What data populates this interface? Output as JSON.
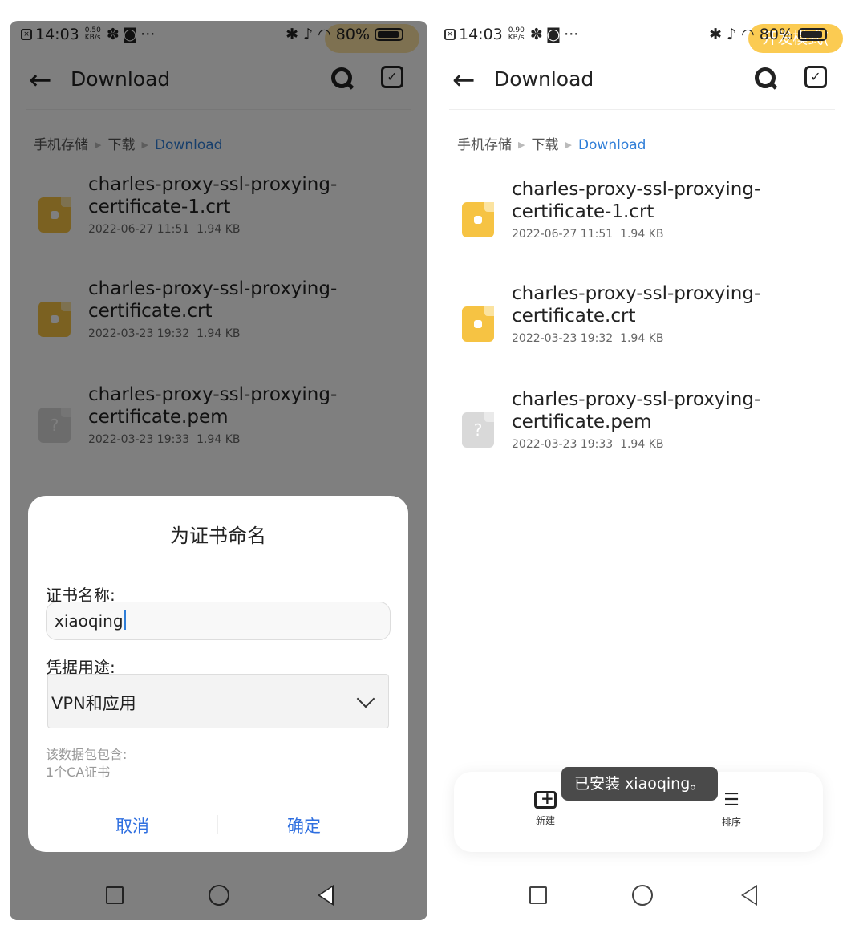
{
  "status_bar_left": {
    "time": "14:03",
    "speed_top": "0.50",
    "speed_unit": "KB/s",
    "battery": "80%"
  },
  "status_bar_right": {
    "time": "14:03",
    "speed_top": "0.90",
    "speed_unit": "KB/s",
    "battery": "80%",
    "dev_mode": "开发模式("
  },
  "appbar": {
    "title": "Download"
  },
  "breadcrumb": {
    "root": "手机存储",
    "parent": "下载",
    "current": "Download"
  },
  "files": [
    {
      "name": "charles-proxy-ssl-proxying-certificate-1.crt",
      "date": "2022-06-27 11:51",
      "size": "1.94 KB",
      "type": "cert"
    },
    {
      "name": "charles-proxy-ssl-proxying-certificate.crt",
      "date": "2022-03-23 19:32",
      "size": "1.94 KB",
      "type": "cert"
    },
    {
      "name": "charles-proxy-ssl-proxying-certificate.pem",
      "date": "2022-03-23 19:33",
      "size": "1.94 KB",
      "type": "unknown",
      "icon_glyph": "?"
    }
  ],
  "dialog": {
    "title": "为证书命名",
    "name_label": "证书名称:",
    "name_value": "xiaoqing",
    "usage_label": "凭据用途:",
    "usage_value": "VPN和应用",
    "info_line1": "该数据包包含:",
    "info_line2": "1个CA证书",
    "cancel": "取消",
    "confirm": "确定"
  },
  "toolbar": {
    "new_label": "新建",
    "sort_label": "排序"
  },
  "toast": {
    "text": "已安装 xiaoqing。"
  },
  "colors": {
    "accent": "#2f7ed8",
    "cert_icon": "#f6c343",
    "dialog_button": "#2f6fe0"
  }
}
